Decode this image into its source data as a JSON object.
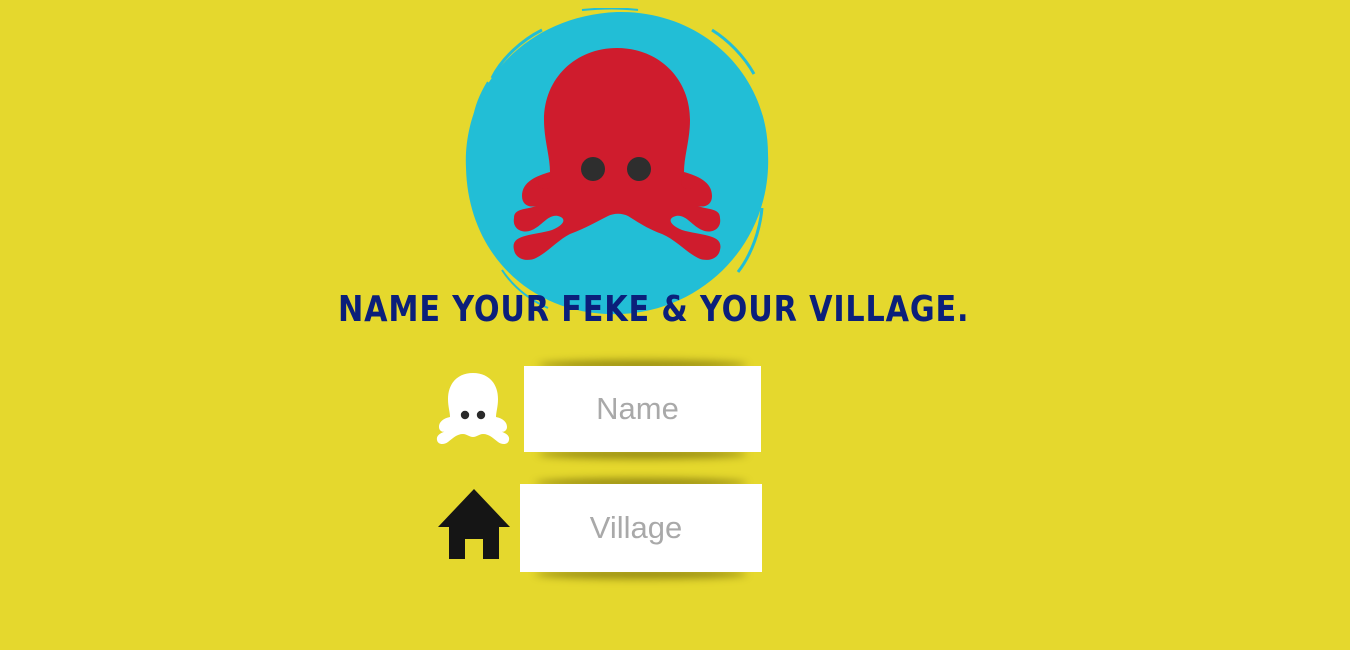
{
  "colors": {
    "background": "#E5D82D",
    "logo_circle": "#22BED6",
    "octopus": "#CF1C2D",
    "octopus_eyes": "#2E2E2E",
    "headline": "#0B1F7A",
    "field_bg": "#FFFFFF",
    "placeholder": "#A9A9A9",
    "octopus_icon": "#FFFFFF",
    "house_icon": "#151515"
  },
  "logo": {
    "icon": "octopus-logo-icon"
  },
  "headline": "Name your Feke & your village.",
  "form": {
    "name": {
      "icon": "octopus-icon",
      "value": "",
      "placeholder": "Name"
    },
    "village": {
      "icon": "house-icon",
      "value": "",
      "placeholder": "Village"
    }
  }
}
